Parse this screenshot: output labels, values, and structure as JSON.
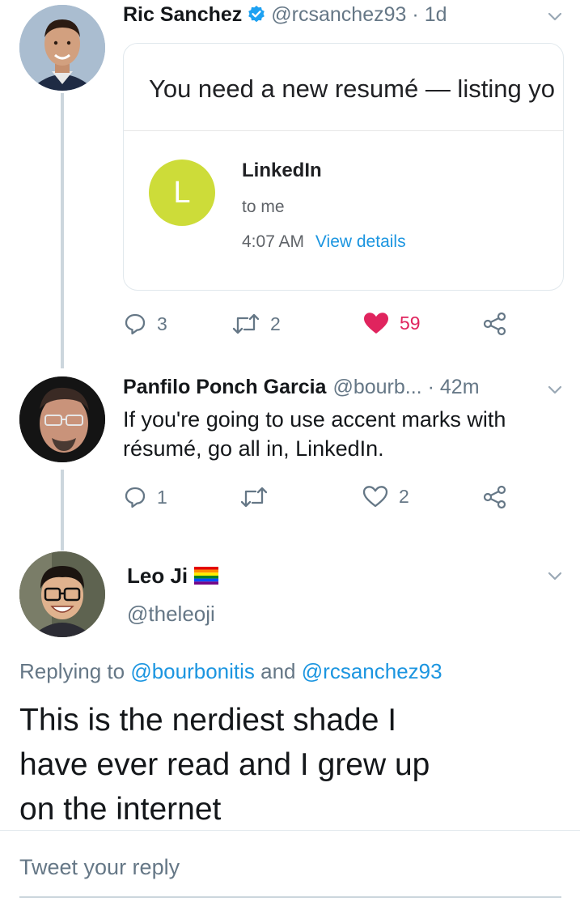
{
  "tweet1": {
    "name": "Ric Sanchez",
    "handle": "@rcsanchez93",
    "time": "· 1d",
    "card": {
      "subject": "You need a new resumé — listing yo",
      "sender_initial": "L",
      "sender_name": "LinkedIn",
      "to": "to me",
      "time": "4:07 AM",
      "details_link": "View details"
    },
    "actions": {
      "replies": "3",
      "retweets": "2",
      "likes": "59"
    }
  },
  "tweet2": {
    "name": "Panfilo Ponch Garcia",
    "handle": "@bourb...",
    "time": "· 42m",
    "text_line1": "If you're going to use accent marks with",
    "text_line2": "résumé, go all in, LinkedIn.",
    "actions": {
      "replies": "1",
      "likes": "2"
    }
  },
  "main_tweet": {
    "name": "Leo Ji",
    "handle": "@theleoji",
    "replying_prefix": "Replying to",
    "replying_user1": "@bourbonitis",
    "replying_and": "and",
    "replying_user2": "@rcsanchez93",
    "text_line1": "This is the nerdiest shade I",
    "text_line2": "have ever read and I grew up",
    "text_line3": "on the internet"
  },
  "reply_box": {
    "placeholder": "Tweet your reply"
  },
  "colors": {
    "like_active": "#e0245e",
    "link": "#1b95e0",
    "verified": "#1da1f2",
    "linkedin_avatar": "#cddc39",
    "icon_grey": "#657786"
  }
}
